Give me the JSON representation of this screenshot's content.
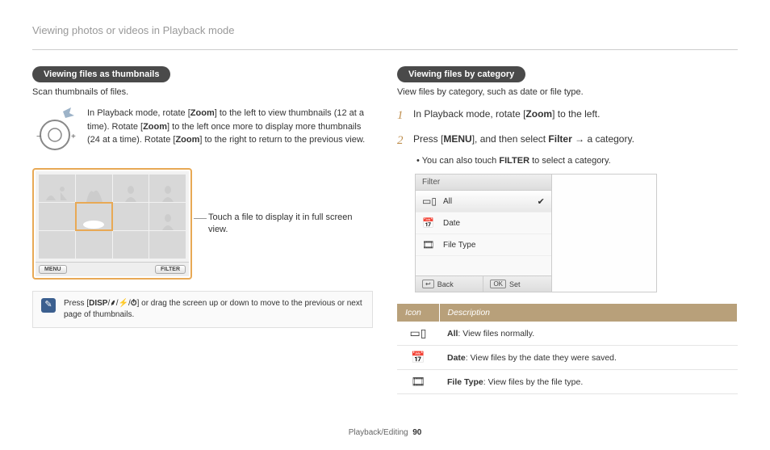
{
  "page_title": "Viewing photos or videos in Playback mode",
  "left": {
    "pill": "Viewing files as thumbnails",
    "subtext": "Scan thumbnails of files.",
    "instruction_p1": "In Playback mode, rotate [",
    "instruction_z1": "Zoom",
    "instruction_p2": "] to the left to view thumbnails (12 at a time). Rotate [",
    "instruction_z2": "Zoom",
    "instruction_p3": "] to the left once more to display more thumbnails (24 at a time). Rotate [",
    "instruction_z3": "Zoom",
    "instruction_p4": "] to the right to return to the previous view.",
    "grid_caption": "Touch a file to display it in full screen view.",
    "menu_btn": "MENU",
    "filter_btn": "FILTER",
    "note_pre": "Press [",
    "note_disp": "DISP",
    "note_post": "] or drag the screen up or down to move to the previous or next page of thumbnails."
  },
  "right": {
    "pill": "Viewing files by category",
    "subtext": "View files by category, such as date or file type.",
    "step1_pre": "In Playback mode, rotate [",
    "step1_zoom": "Zoom",
    "step1_post": "] to the left.",
    "step2_pre": "Press [",
    "step2_menu": "MENU",
    "step2_mid": "], and then select ",
    "step2_filter": "Filter",
    "step2_arrow": " → ",
    "step2_post": "a category.",
    "sub_bullet_pre": "You can also touch ",
    "sub_bullet_bold": "FILTER",
    "sub_bullet_post": " to select a category.",
    "filter": {
      "header": "Filter",
      "all": "All",
      "date": "Date",
      "filetype": "File Type",
      "back": "Back",
      "ok": "OK",
      "set": "Set"
    },
    "table": {
      "h1": "Icon",
      "h2": "Description",
      "rows": [
        {
          "bold": "All",
          "rest": ": View files normally."
        },
        {
          "bold": "Date",
          "rest": ": View files by the date they were saved."
        },
        {
          "bold": "File Type",
          "rest": ": View files by the file type."
        }
      ]
    }
  },
  "footer": {
    "section": "Playback/Editing",
    "page": "90"
  }
}
